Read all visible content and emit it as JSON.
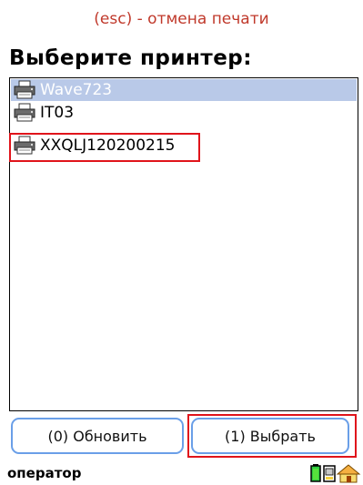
{
  "header": {
    "hint": "(esc) - отмена печати",
    "title": "Выберите принтер:"
  },
  "printers": [
    {
      "name": "Wave723",
      "selected": true,
      "icon": "printer-icon"
    },
    {
      "name": "IT03",
      "selected": false,
      "icon": "printer-icon"
    },
    {
      "name": "XXQLJ120200215",
      "selected": false,
      "icon": "printer-icon"
    }
  ],
  "buttons": {
    "refresh": "(0) Обновить",
    "select": "(1) Выбрать"
  },
  "status": {
    "user": "оператор",
    "icons": [
      "battery-icon",
      "device-icon",
      "home-icon"
    ]
  },
  "colors": {
    "hint": "#c0392b",
    "selection": "#b9c9e8",
    "annotation": "#e0141b",
    "button_border": "#6a9fe8"
  }
}
